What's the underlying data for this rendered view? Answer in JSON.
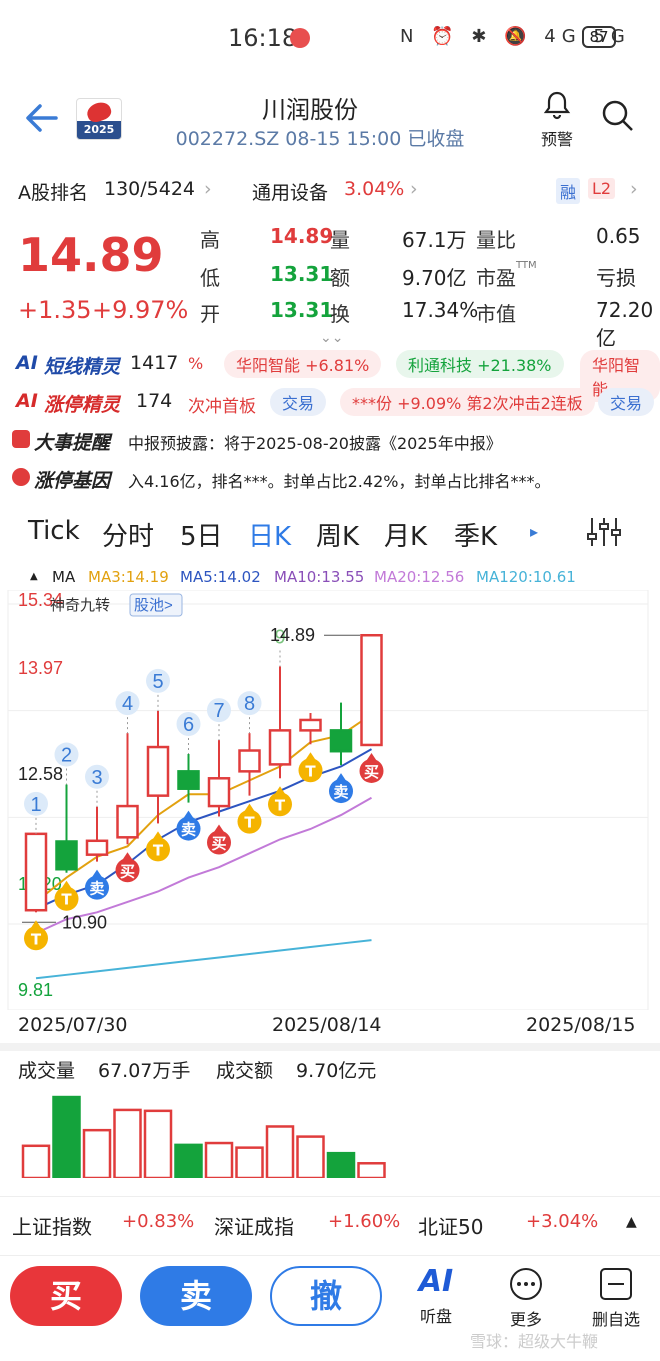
{
  "status": {
    "time": "16:18",
    "battery": "87",
    "icons": "N ⏰ ✱ 🔕 4G 5G"
  },
  "header": {
    "title": "川润股份",
    "subtitle": "002272.SZ 08-15 15:00 已收盘",
    "logo_year": "2025",
    "alert_label": "预警"
  },
  "rank": {
    "label": "A股排名",
    "value": "130/5424",
    "sector": "通用设备",
    "sector_change": "3.04%",
    "badge1": "融",
    "badge2": "L2"
  },
  "quote": {
    "price": "14.89",
    "change": "+1.35",
    "change_pct": "+9.97%",
    "rows": [
      {
        "l1": "高",
        "v1": "14.89",
        "l2": "量",
        "v2": "67.1万",
        "l3": "量比",
        "v3": "0.65"
      },
      {
        "l1": "低",
        "v1": "13.31",
        "l2": "额",
        "v2": "9.70亿",
        "l3": "市盈",
        "l3s": "TTM",
        "v3": "亏损"
      },
      {
        "l1": "开",
        "v1": "13.31",
        "l2": "换",
        "v2": "17.34%",
        "l3": "市值",
        "v3": "72.20亿"
      }
    ]
  },
  "ai1": {
    "label": "短线精灵",
    "count": "1417",
    "pre": "%",
    "tags": [
      "华阳智能 +6.81%",
      "利通科技 +21.38%",
      "华阳智能"
    ]
  },
  "ai2": {
    "label": "涨停精灵",
    "count": "174",
    "t1": "次冲首板",
    "t2": "交易",
    "t3": "***份 +9.09% 第2次冲击2连板",
    "t4": "交易"
  },
  "news1": {
    "label": "大事提醒",
    "text": "中报预披露：将于2025-08-20披露《2025年中报》"
  },
  "news2": {
    "label": "涨停基因",
    "text": "入4.16亿，排名***。封单占比2.42%，封单占比排名***。"
  },
  "tabs": [
    "Tick",
    "分时",
    "5日",
    "日K",
    "周K",
    "月K",
    "季K"
  ],
  "ma": {
    "label": "MA",
    "ma3": "MA3:14.19",
    "ma5": "MA5:14.02",
    "ma10": "MA10:13.55",
    "ma20": "MA20:12.56",
    "ma120": "MA120:10.61"
  },
  "chart_data": {
    "type": "candlestick",
    "ylabels": [
      "15.34",
      "13.97",
      "12.58",
      "11.20",
      "9.81"
    ],
    "x_labels": [
      "2025/07/30",
      "2025/08/14",
      "2025/08/15"
    ],
    "high_label": "14.89",
    "low_label": "10.90",
    "badge_nine": "神奇九转",
    "pool": "股池>",
    "candles": [
      {
        "o": 10.93,
        "c": 12.03,
        "h": 12.03,
        "l": 10.9,
        "up": true,
        "n": "1"
      },
      {
        "o": 11.92,
        "c": 11.52,
        "h": 12.74,
        "l": 11.47,
        "up": false,
        "n": "2"
      },
      {
        "o": 11.73,
        "c": 11.93,
        "h": 12.42,
        "l": 11.63,
        "up": true,
        "n": "3"
      },
      {
        "o": 11.98,
        "c": 12.43,
        "h": 13.48,
        "l": 11.88,
        "up": true,
        "n": "4"
      },
      {
        "o": 12.58,
        "c": 13.28,
        "h": 13.8,
        "l": 12.18,
        "up": true,
        "n": "5"
      },
      {
        "o": 12.93,
        "c": 12.68,
        "h": 13.18,
        "l": 12.48,
        "up": false,
        "n": "6"
      },
      {
        "o": 12.43,
        "c": 12.83,
        "h": 13.38,
        "l": 12.28,
        "up": true,
        "n": "7"
      },
      {
        "o": 12.93,
        "c": 13.23,
        "h": 13.48,
        "l": 12.58,
        "up": true,
        "n": "8"
      },
      {
        "o": 13.03,
        "c": 13.52,
        "h": 14.44,
        "l": 12.83,
        "up": true,
        "n": "9"
      },
      {
        "o": 13.52,
        "c": 13.67,
        "h": 13.77,
        "l": 13.32,
        "up": true,
        "n": ""
      },
      {
        "o": 13.52,
        "c": 13.22,
        "h": 13.92,
        "l": 13.02,
        "up": false,
        "n": ""
      },
      {
        "o": 13.31,
        "c": 14.89,
        "h": 14.89,
        "l": 13.31,
        "up": true,
        "n": ""
      }
    ],
    "ma3": [
      11.05,
      11.4,
      11.7,
      11.85,
      12.3,
      12.6,
      12.6,
      12.8,
      13.0,
      13.35,
      13.45,
      13.75
    ],
    "ma5": [
      10.95,
      11.15,
      11.3,
      11.6,
      11.95,
      12.2,
      12.35,
      12.5,
      12.65,
      12.85,
      13.0,
      13.25
    ],
    "ma20": [
      10.6,
      10.8,
      10.9,
      11.05,
      11.2,
      11.4,
      11.55,
      11.75,
      11.95,
      12.1,
      12.3,
      12.55
    ],
    "ma120": [
      9.95,
      10.0,
      10.05,
      10.1,
      10.15,
      10.2,
      10.25,
      10.3,
      10.35,
      10.4,
      10.45,
      10.5
    ],
    "signals": [
      {
        "i": 0,
        "t": "T",
        "pos": "below"
      },
      {
        "i": 1,
        "t": "T",
        "pos": "below"
      },
      {
        "i": 2,
        "t": "卖",
        "pos": "below"
      },
      {
        "i": 3,
        "t": "买",
        "pos": "below"
      },
      {
        "i": 4,
        "t": "T",
        "pos": "below"
      },
      {
        "i": 5,
        "t": "卖",
        "pos": "below"
      },
      {
        "i": 6,
        "t": "买",
        "pos": "below"
      },
      {
        "i": 7,
        "t": "T",
        "pos": "below"
      },
      {
        "i": 8,
        "t": "T",
        "pos": "below"
      },
      {
        "i": 9,
        "t": "T",
        "pos": "below"
      },
      {
        "i": 10,
        "t": "卖",
        "pos": "below"
      },
      {
        "i": 11,
        "t": "买",
        "pos": "below"
      }
    ],
    "volume": {
      "label": "成交量",
      "value": "67.07万手",
      "amt_label": "成交额",
      "amt": "9.70亿元",
      "values": [
        35,
        88,
        52,
        74,
        73,
        36,
        38,
        33,
        56,
        45,
        27,
        16
      ],
      "max": 100
    }
  },
  "indices": [
    {
      "name": "上证指数",
      "chg": "+0.83%"
    },
    {
      "name": "深证成指",
      "chg": "+1.60%"
    },
    {
      "name": "北证50",
      "chg": "+3.04%"
    }
  ],
  "bottom": {
    "buy": "买",
    "sell": "卖",
    "cancel": "撤",
    "ai": "AI",
    "ai_label": "听盘",
    "more": "更多",
    "del": "删自选",
    "watermark": "雪球：超级大牛鞭"
  }
}
